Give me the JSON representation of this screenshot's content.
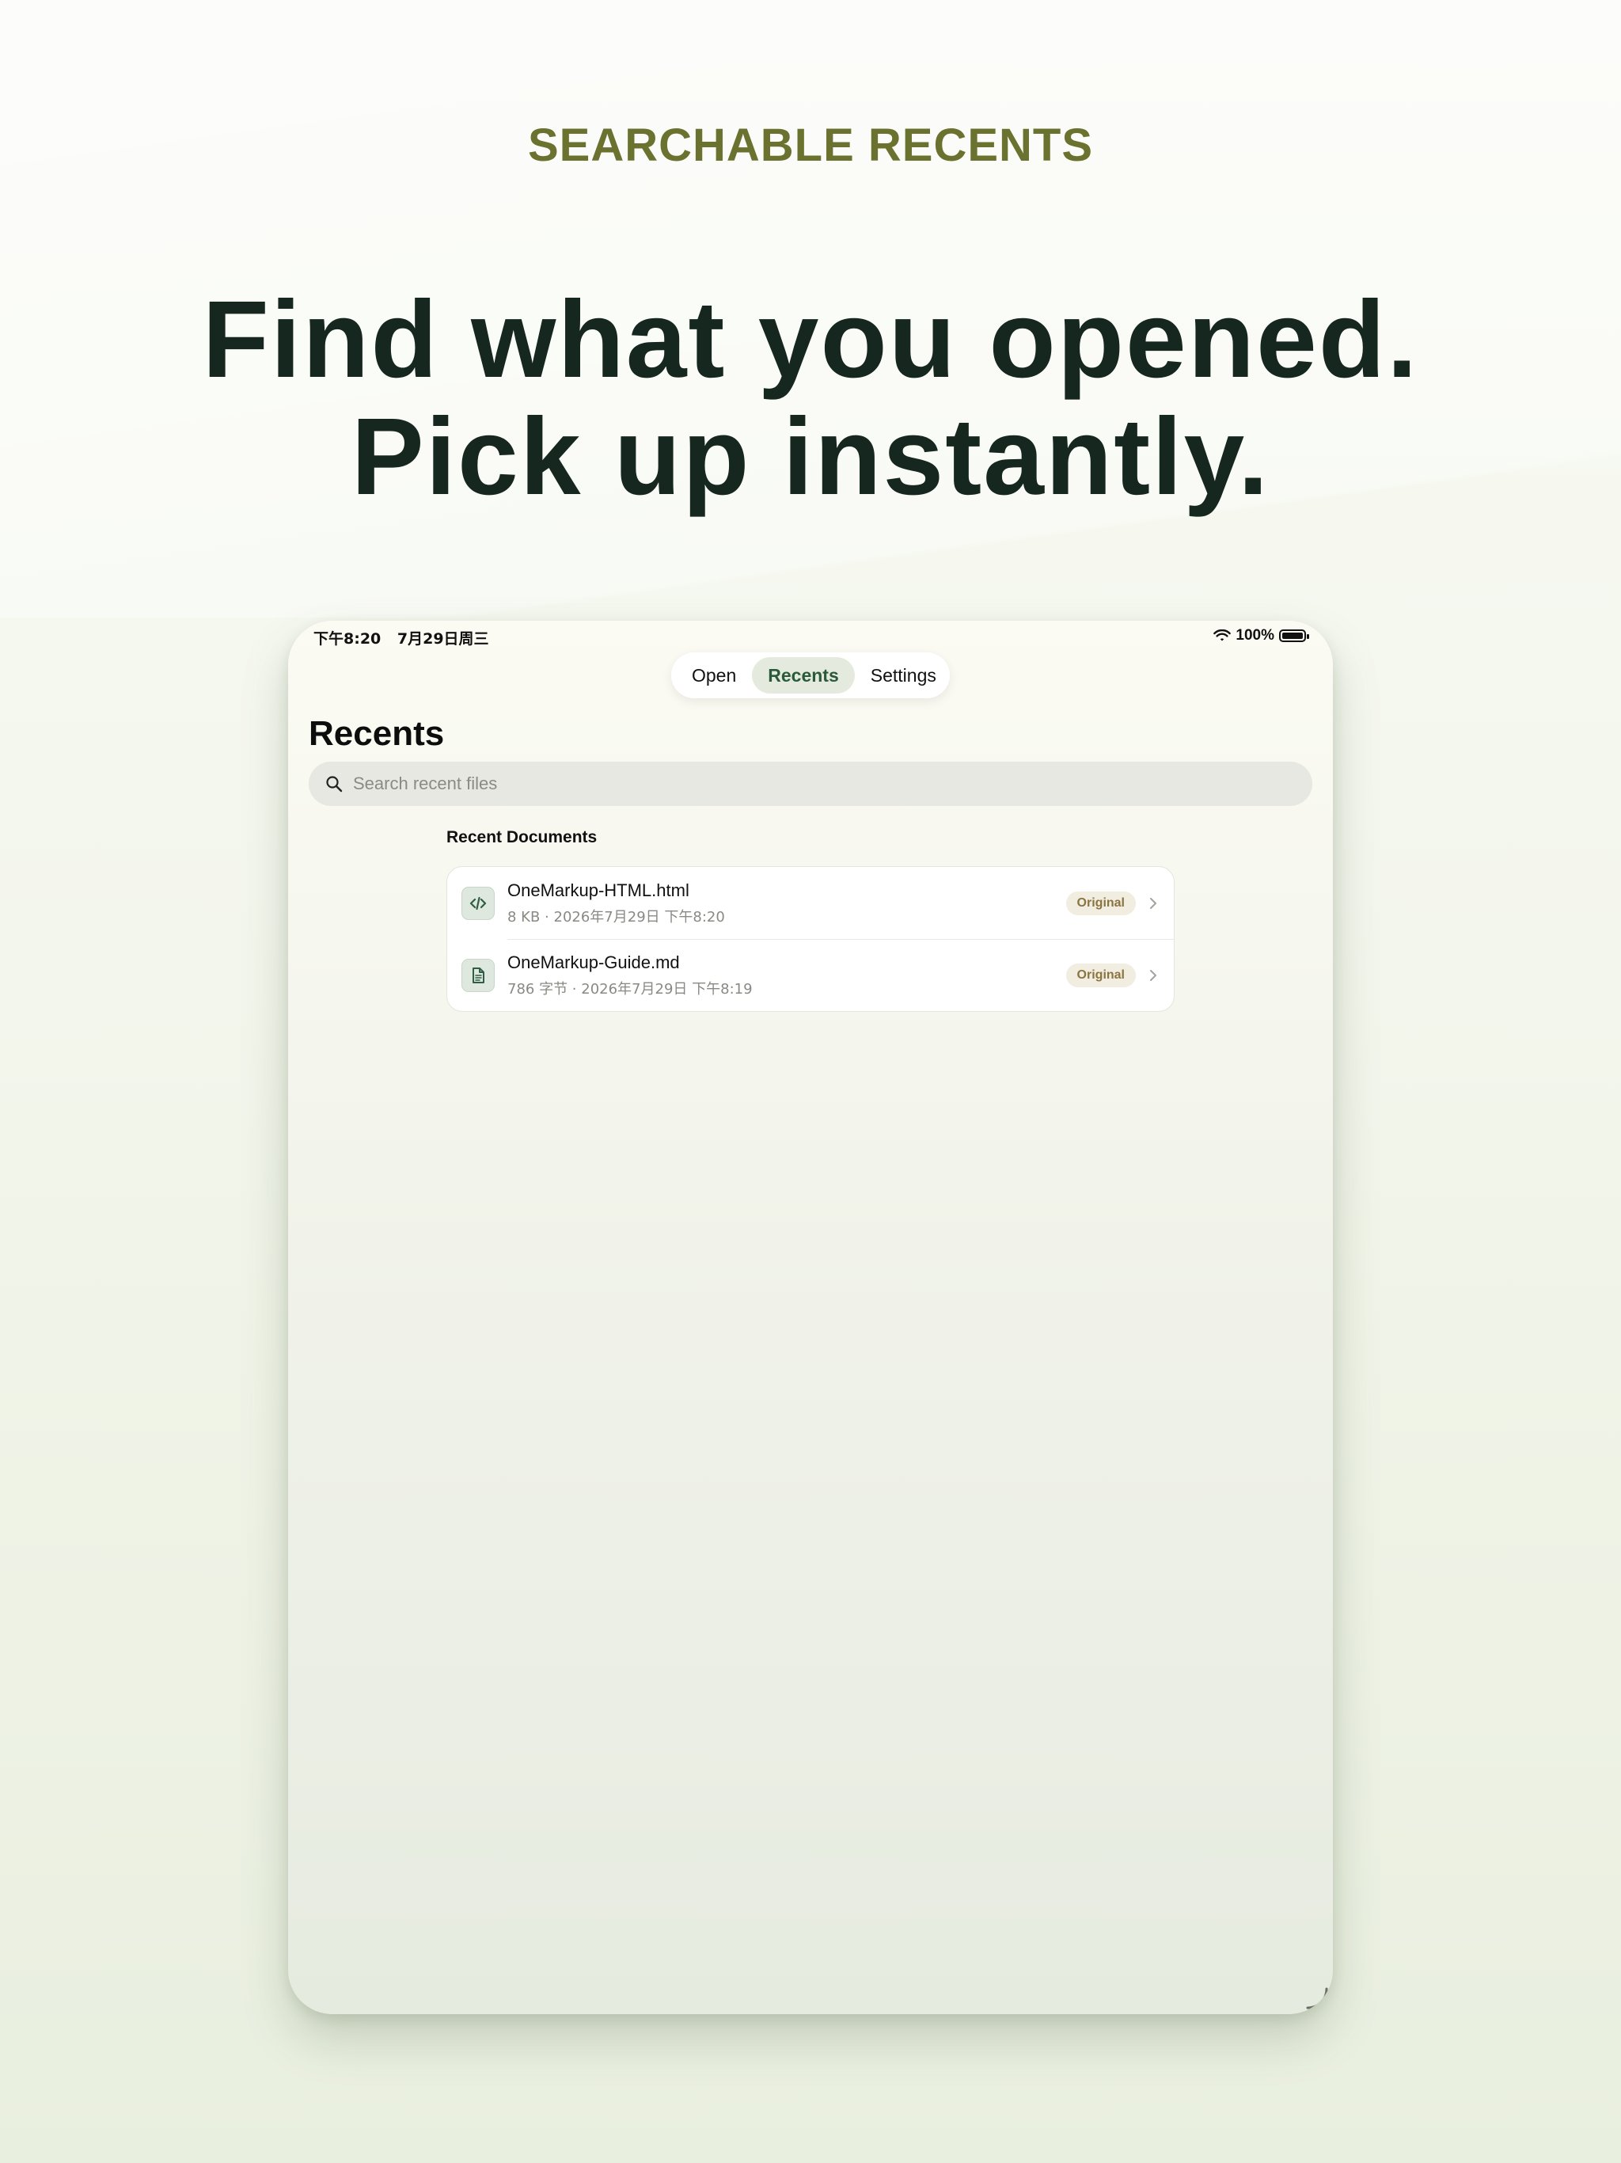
{
  "eyebrow": "SEARCHABLE RECENTS",
  "headline": {
    "line1": "Find what you opened.",
    "line2": "Pick up instantly."
  },
  "status_bar": {
    "time": "下午8:20",
    "date": "7月29日周三",
    "battery": "100%"
  },
  "tabs": [
    {
      "label": "Open",
      "active": false
    },
    {
      "label": "Recents",
      "active": true
    },
    {
      "label": "Settings",
      "active": false
    }
  ],
  "page_title": "Recents",
  "search": {
    "placeholder": "Search recent files",
    "value": ""
  },
  "section_label": "Recent Documents",
  "files": [
    {
      "name": "OneMarkup-HTML.html",
      "meta": "8 KB · 2026年7月29日 下午8:20",
      "badge": "Original",
      "icon": "code-file-icon"
    },
    {
      "name": "OneMarkup-Guide.md",
      "meta": "786 字节 · 2026年7月29日 下午8:19",
      "badge": "Original",
      "icon": "document-file-icon"
    }
  ],
  "colors": {
    "eyebrow": "#6b7230",
    "headline": "#15271e",
    "active_tab_bg": "#e4ebde",
    "badge_bg": "#f1ede0",
    "badge_text": "#8a7440"
  }
}
